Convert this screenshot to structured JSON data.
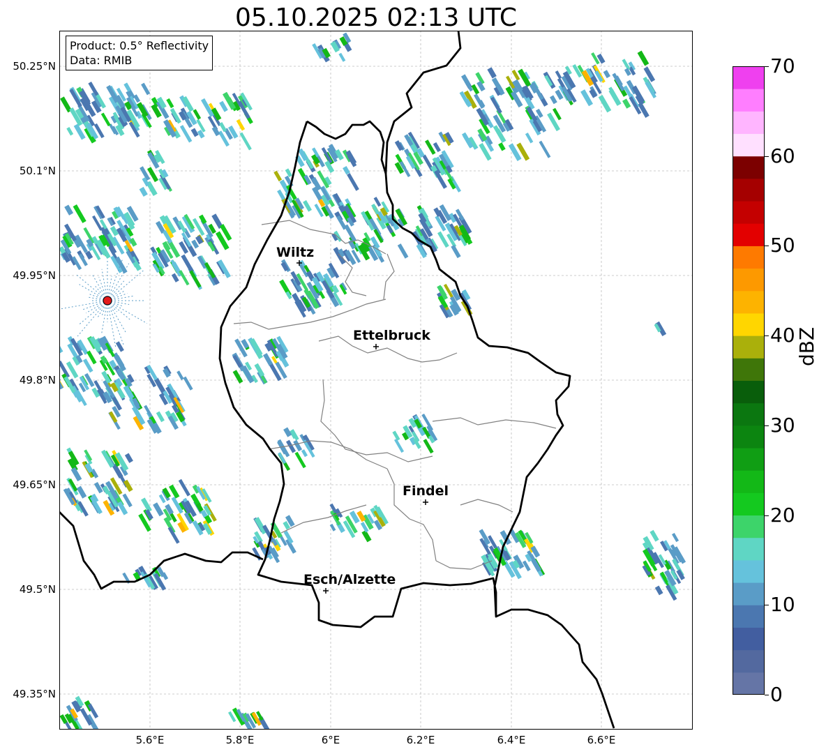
{
  "title": "05.10.2025 02:13 UTC",
  "info": {
    "product": "Product: 0.5° Reflectivity",
    "data": "Data: RMIB"
  },
  "latitude_labels": [
    "50.25°N",
    "50.1°N",
    "49.95°N",
    "49.8°N",
    "49.65°N",
    "49.5°N",
    "49.35°N"
  ],
  "longitude_labels": [
    "5.6°E",
    "5.8°E",
    "6°E",
    "6.2°E",
    "6.4°E",
    "6.6°E"
  ],
  "cities": [
    {
      "name": "Wiltz"
    },
    {
      "name": "Ettelbruck"
    },
    {
      "name": "Findel"
    },
    {
      "name": "Esch/Alzette"
    }
  ],
  "colorbar": {
    "label": "dBZ",
    "ticks": [
      "0",
      "10",
      "20",
      "30",
      "40",
      "50",
      "60",
      "70"
    ],
    "colors": [
      "#6575a6",
      "#53699f",
      "#425ea0",
      "#4b77b0",
      "#5a9cc7",
      "#65c2dc",
      "#5fd6c4",
      "#3dd46a",
      "#14c91f",
      "#13b817",
      "#109e14",
      "#0c8510",
      "#0b7710",
      "#095e0b",
      "#3f7609",
      "#aab00b",
      "#ffd600",
      "#fdb300",
      "#fd9900",
      "#fe7a00",
      "#e30000",
      "#c40000",
      "#a50000",
      "#7c0000",
      "#ffe0ff",
      "#ffb5ff",
      "#ff7eff",
      "#ef40ef"
    ]
  },
  "radar_site_color": "#e41a1c"
}
